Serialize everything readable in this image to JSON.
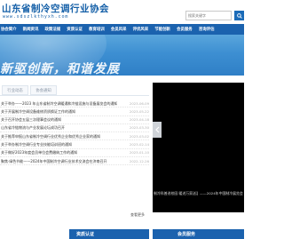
{
  "header": {
    "title": "山东省制冷空调行业协会",
    "subtitle": "www.sdszlkthyxh.com"
  },
  "search": {
    "placeholder": "搜索关键字"
  },
  "nav": {
    "items": [
      "协会简介",
      "新闻资讯",
      "政策法规",
      "资质认证",
      "教育培训",
      "会员风采",
      "评优风采",
      "节能创新",
      "会员服务",
      "咨询评估"
    ]
  },
  "banner": {
    "slogan": "新驱创新，和谐发展"
  },
  "tabs": [
    {
      "label": "行业动态"
    },
    {
      "label": "协会通知"
    }
  ],
  "news": [
    {
      "title": "关于举办——2023 年山东省制冷空调暖通和冷链设施与设备展览会的通知",
      "date": "2023-06-09"
    },
    {
      "title": "关于开展制冷空调设备维修资质换证工作的通知",
      "date": "2023-05-22"
    },
    {
      "title": "关于召开协会五届三次理事会议的通知",
      "date": "2023-04-18"
    },
    {
      "title": "山东省冷链物流与产业发展论坛成功召开",
      "date": "2023-03-30"
    },
    {
      "title": "关于推荐申报山东省制冷空调行业优秀企业和优秀企业家的通知",
      "date": "2023-03-02"
    },
    {
      "title": "关于举办制冷空调行业专业技能培训班的通知",
      "date": "2023-02-14"
    },
    {
      "title": "关于做好2023年度会员单位会费缴纳工作的通知",
      "date": "2023-01-10"
    },
    {
      "title": "聚焦·绿色节能——2024年中国制冷空调行业技术交流会在济南召开",
      "date": "2022-12-26"
    }
  ],
  "more": "查看更多",
  "slideshow": {
    "caption_left": "制冷科普进校园 暖进万家送温",
    "caption_right": "——2024年中国制冷展览会"
  },
  "bottom": {
    "left_label": "资质认证",
    "right_label": "会员服务"
  },
  "colors": {
    "brand_blue": "#1b62ae",
    "title_blue": "#1560a8"
  }
}
